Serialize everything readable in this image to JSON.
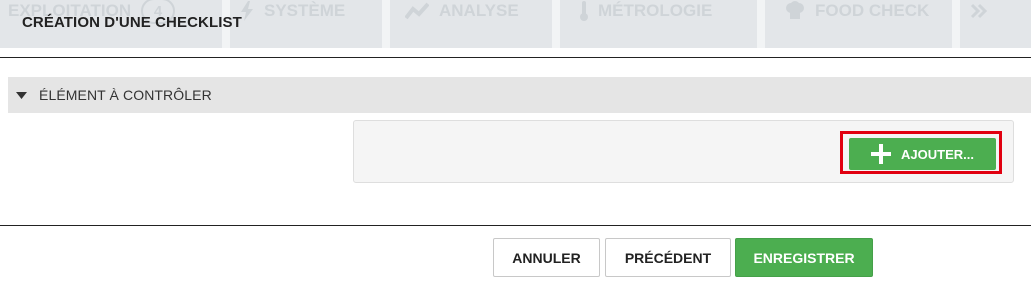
{
  "background_nav": {
    "items": [
      {
        "label": "EXPLOITATION",
        "badge": "4"
      },
      {
        "label": "SYSTÈME",
        "icon": "bolt-icon"
      },
      {
        "label": "ANALYSE",
        "icon": "chart-line-icon"
      },
      {
        "label": "MÉTROLOGIE",
        "icon": "thermometer-icon"
      },
      {
        "label": "FOOD CHECK",
        "icon": "chef-hat-icon"
      }
    ],
    "more_icon": "double-chevron-right-icon"
  },
  "modal": {
    "title": "CRÉATION D'UNE CHECKLIST"
  },
  "section": {
    "title": "ÉLÉMENT À CONTRÔLER",
    "add_button_label": "AJOUTER..."
  },
  "footer": {
    "cancel_label": "ANNULER",
    "previous_label": "PRÉCÉDENT",
    "save_label": "ENREGISTRER"
  },
  "colors": {
    "primary_green": "#4cae50",
    "highlight_red": "#e10010",
    "section_bg": "#e5e5e5"
  }
}
